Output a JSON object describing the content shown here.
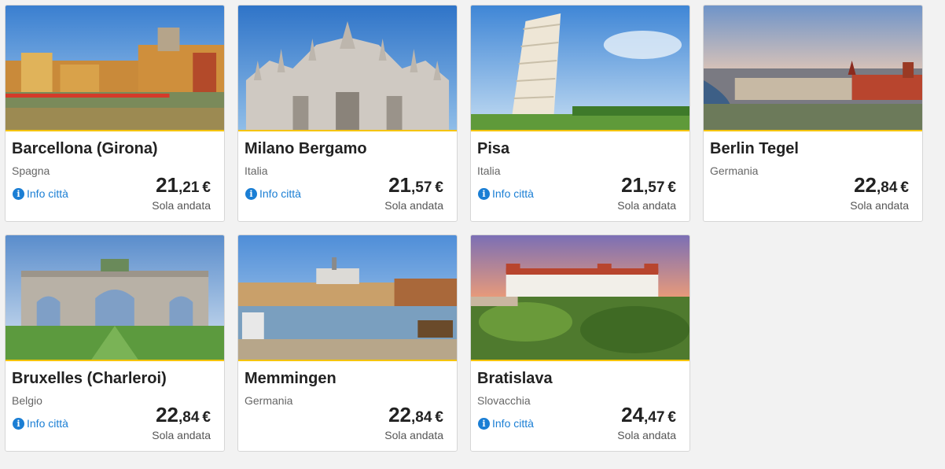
{
  "cards": [
    {
      "city": "Barcellona (Girona)",
      "country": "Spagna",
      "info": "Info città",
      "show_info": true,
      "price_int": "21",
      "price_dec": ",21",
      "currency": "€",
      "fare": "Sola andata",
      "image": "girona-riverside-houses"
    },
    {
      "city": "Milano Bergamo",
      "country": "Italia",
      "info": "Info città",
      "show_info": true,
      "price_int": "21",
      "price_dec": ",57",
      "currency": "€",
      "fare": "Sola andata",
      "image": "milan-cathedral"
    },
    {
      "city": "Pisa",
      "country": "Italia",
      "info": "Info città",
      "show_info": true,
      "price_int": "21",
      "price_dec": ",57",
      "currency": "€",
      "fare": "Sola andata",
      "image": "leaning-tower-pisa"
    },
    {
      "city": "Berlin Tegel",
      "country": "Germania",
      "info": "",
      "show_info": false,
      "price_int": "22",
      "price_dec": ",84",
      "currency": "€",
      "fare": "Sola andata",
      "image": "berlin-river-skyline"
    },
    {
      "city": "Bruxelles (Charleroi)",
      "country": "Belgio",
      "info": "Info città",
      "show_info": true,
      "price_int": "22",
      "price_dec": ",84",
      "currency": "€",
      "fare": "Sola andata",
      "image": "brussels-cinquantenaire-arch"
    },
    {
      "city": "Memmingen",
      "country": "Germania",
      "info": "",
      "show_info": false,
      "price_int": "22",
      "price_dec": ",84",
      "currency": "€",
      "fare": "Sola andata",
      "image": "memmingen-lakeside"
    },
    {
      "city": "Bratislava",
      "country": "Slovacchia",
      "info": "Info città",
      "show_info": true,
      "price_int": "24",
      "price_dec": ",47",
      "currency": "€",
      "fare": "Sola andata",
      "image": "bratislava-castle"
    }
  ],
  "colors": {
    "accent_line": "#f5c400",
    "link": "#1a7ed4",
    "card_bg": "#ffffff",
    "page_bg": "#f2f2f2"
  }
}
